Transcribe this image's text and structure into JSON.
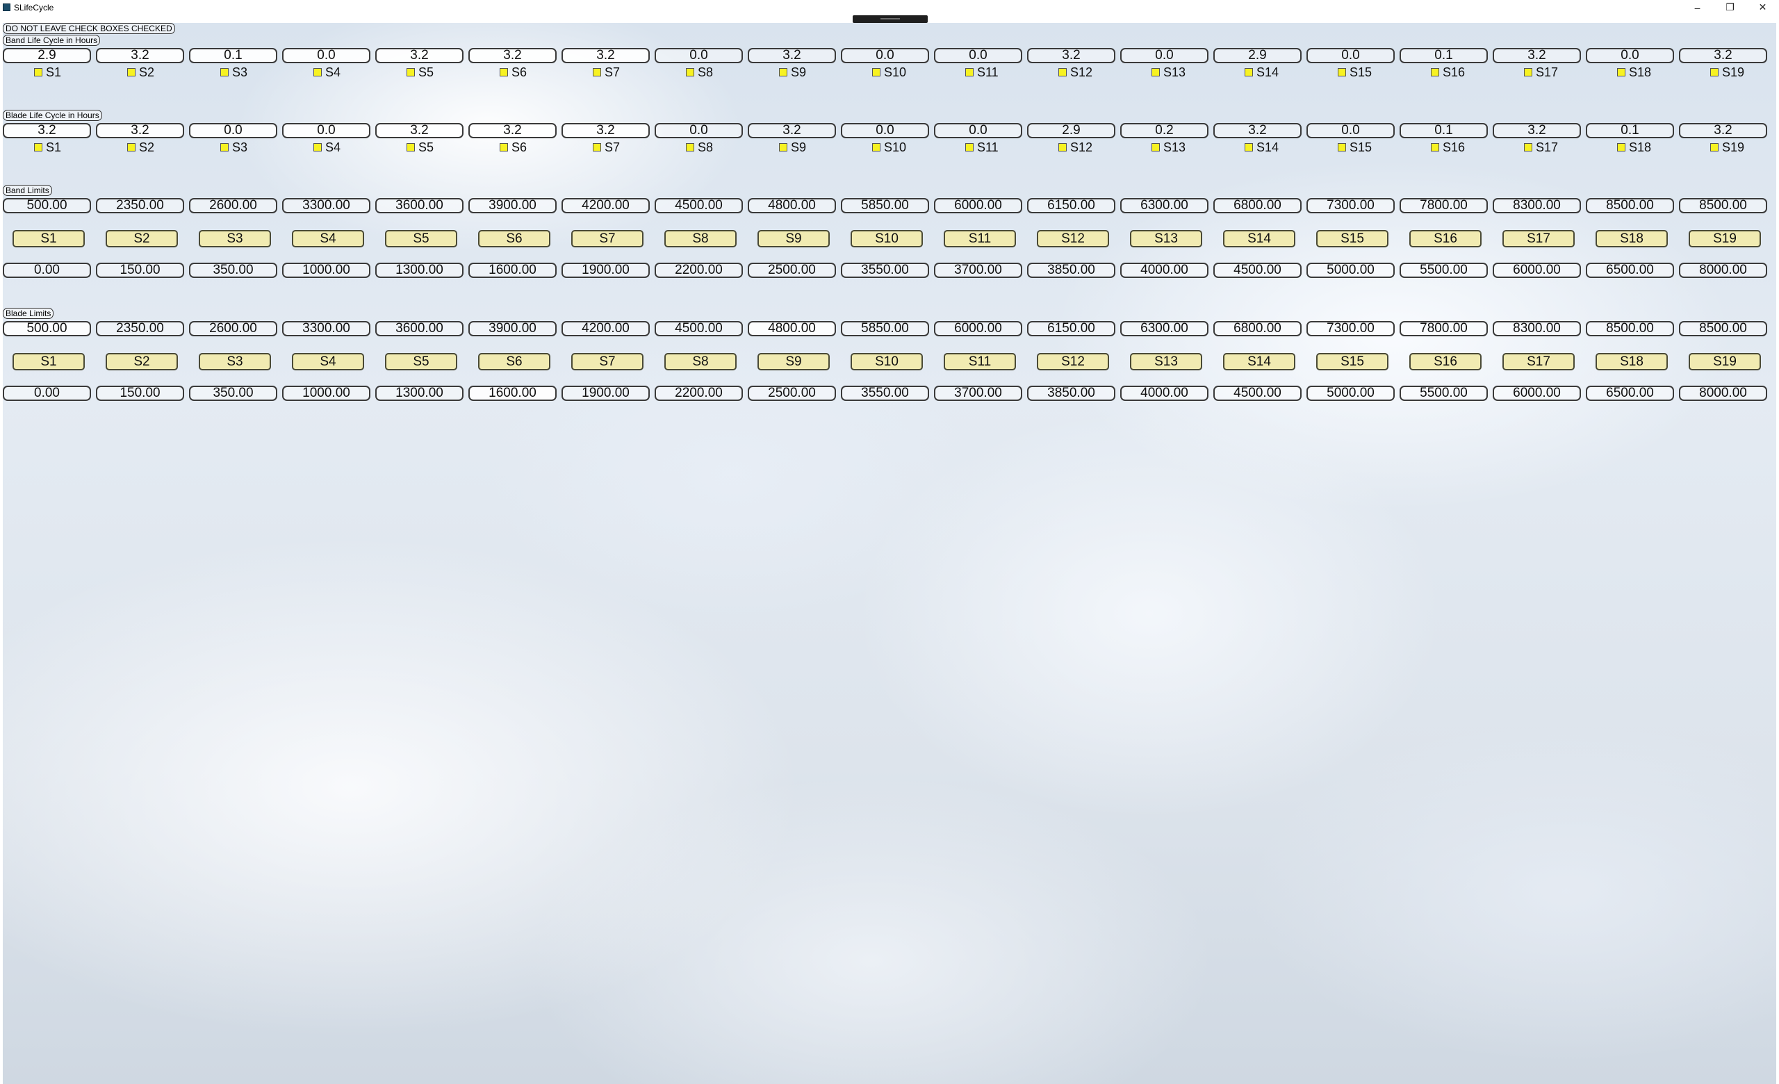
{
  "window": {
    "title": "SLifeCycle",
    "icon": "app-icon",
    "controls": [
      "minimize-icon",
      "restore-icon",
      "close-icon"
    ]
  },
  "warning_label": "DO NOT LEAVE CHECK BOXES CHECKED",
  "band_life": {
    "label": "Band Life Cycle in Hours",
    "values": [
      "2.9",
      "3.2",
      "0.1",
      "0.0",
      "3.2",
      "3.2",
      "3.2",
      "0.0",
      "3.2",
      "0.0",
      "0.0",
      "3.2",
      "0.0",
      "2.9",
      "0.0",
      "0.1",
      "3.2",
      "0.0",
      "3.2"
    ],
    "checkboxes": [
      "S1",
      "S2",
      "S3",
      "S4",
      "S5",
      "S6",
      "S7",
      "S8",
      "S9",
      "S10",
      "S11",
      "S12",
      "S13",
      "S14",
      "S15",
      "S16",
      "S17",
      "S18",
      "S19"
    ]
  },
  "blade_life": {
    "label": "Blade Life Cycle in Hours",
    "values": [
      "3.2",
      "3.2",
      "0.0",
      "0.0",
      "3.2",
      "3.2",
      "3.2",
      "0.0",
      "3.2",
      "0.0",
      "0.0",
      "2.9",
      "0.2",
      "3.2",
      "0.0",
      "0.1",
      "3.2",
      "0.1",
      "3.2"
    ],
    "checkboxes": [
      "S1",
      "S2",
      "S3",
      "S4",
      "S5",
      "S6",
      "S7",
      "S8",
      "S9",
      "S10",
      "S11",
      "S12",
      "S13",
      "S14",
      "S15",
      "S16",
      "S17",
      "S18",
      "S19"
    ]
  },
  "band_limits": {
    "label": "Band Limits",
    "upper": [
      "500.00",
      "2350.00",
      "2600.00",
      "3300.00",
      "3600.00",
      "3900.00",
      "4200.00",
      "4500.00",
      "4800.00",
      "5850.00",
      "6000.00",
      "6150.00",
      "6300.00",
      "6800.00",
      "7300.00",
      "7800.00",
      "8300.00",
      "8500.00",
      "8500.00"
    ],
    "buttons": [
      "S1",
      "S2",
      "S3",
      "S4",
      "S5",
      "S6",
      "S7",
      "S8",
      "S9",
      "S10",
      "S11",
      "S12",
      "S13",
      "S14",
      "S15",
      "S16",
      "S17",
      "S18",
      "S19"
    ],
    "lower": [
      "0.00",
      "150.00",
      "350.00",
      "1000.00",
      "1300.00",
      "1600.00",
      "1900.00",
      "2200.00",
      "2500.00",
      "3550.00",
      "3700.00",
      "3850.00",
      "4000.00",
      "4500.00",
      "5000.00",
      "5500.00",
      "6000.00",
      "6500.00",
      "8000.00"
    ]
  },
  "blade_limits": {
    "label": "Blade Limits",
    "upper": [
      "500.00",
      "2350.00",
      "2600.00",
      "3300.00",
      "3600.00",
      "3900.00",
      "4200.00",
      "4500.00",
      "4800.00",
      "5850.00",
      "6000.00",
      "6150.00",
      "6300.00",
      "6800.00",
      "7300.00",
      "7800.00",
      "8300.00",
      "8500.00",
      "8500.00"
    ],
    "buttons": [
      "S1",
      "S2",
      "S3",
      "S4",
      "S5",
      "S6",
      "S7",
      "S8",
      "S9",
      "S10",
      "S11",
      "S12",
      "S13",
      "S14",
      "S15",
      "S16",
      "S17",
      "S18",
      "S19"
    ],
    "lower": [
      "0.00",
      "150.00",
      "350.00",
      "1000.00",
      "1300.00",
      "1600.00",
      "1900.00",
      "2200.00",
      "2500.00",
      "3550.00",
      "3700.00",
      "3850.00",
      "4000.00",
      "4500.00",
      "5000.00",
      "5500.00",
      "6000.00",
      "6500.00",
      "8000.00"
    ]
  },
  "colors": {
    "button_fill": "#f1ebb2",
    "checkbox_fill": "#f7f222",
    "border": "#3a3a3a"
  }
}
